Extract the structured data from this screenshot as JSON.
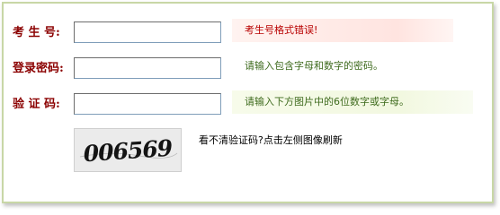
{
  "form": {
    "candidate_no": {
      "label": "考 生 号:",
      "value": "",
      "message": "考生号格式错误!"
    },
    "password": {
      "label": "登录密码:",
      "value": "",
      "message": "请输入包含字母和数字的密码。"
    },
    "captcha": {
      "label": "验 证 码:",
      "value": "",
      "message": "请输入下方图片中的6位数字或字母。",
      "image_text": "006569",
      "refresh_text": "看不清验证码?点击左侧图像刷新"
    }
  },
  "colors": {
    "label": "#8b0000",
    "error_text": "#b80000",
    "hint_text": "#3f6b1e",
    "panel_border": "#c8d7a6"
  }
}
